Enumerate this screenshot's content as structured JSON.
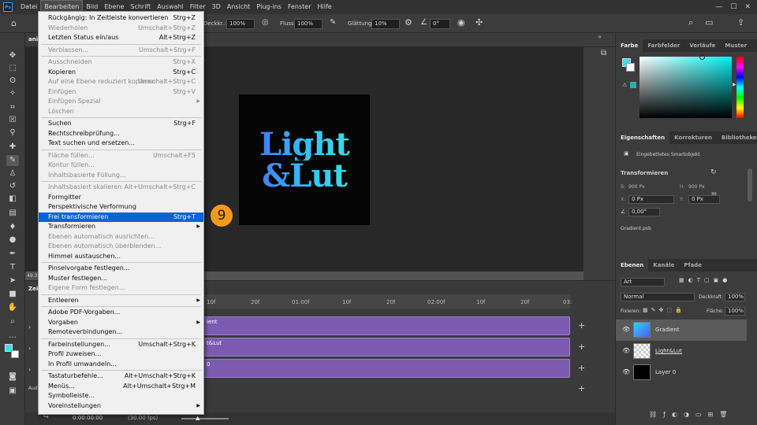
{
  "menubar": {
    "items": [
      "Datei",
      "Bearbeiten",
      "Bild",
      "Ebene",
      "Schrift",
      "Auswahl",
      "Filter",
      "3D",
      "Ansicht",
      "Plug-ins",
      "Fenster",
      "Hilfe"
    ],
    "active_index": 1
  },
  "options": {
    "deckkr_label": "Deckkr.:",
    "deckkr_value": "100%",
    "fluss_label": "Fluss:",
    "fluss_value": "100%",
    "glaettung_label": "Glättung:",
    "glaettung_value": "10%",
    "angle_value": "0°"
  },
  "doc": {
    "tab_title": "ani",
    "zoom": "49.3",
    "artboard_line1": "Light",
    "artboard_line2": "&Lut"
  },
  "badge": {
    "number": "9"
  },
  "menu": {
    "rows": [
      {
        "label": "Rückgängig: In Zeitleiste konvertieren",
        "shortcut": "Strg+Z",
        "disabled": false
      },
      {
        "label": "Wiederholen",
        "shortcut": "Umschalt+Strg+Z",
        "disabled": true
      },
      {
        "label": "Letzten Status ein/aus",
        "shortcut": "Alt+Strg+Z",
        "disabled": false
      },
      {
        "sep": true
      },
      {
        "label": "Verblassen...",
        "shortcut": "Umschalt+Strg+F",
        "disabled": true
      },
      {
        "sep": true
      },
      {
        "label": "Ausschneiden",
        "shortcut": "Strg+X",
        "disabled": true
      },
      {
        "label": "Kopieren",
        "shortcut": "Strg+C",
        "disabled": false
      },
      {
        "label": "Auf eine Ebene reduziert kopieren",
        "shortcut": "Umschalt+Strg+C",
        "disabled": true
      },
      {
        "label": "Einfügen",
        "shortcut": "Strg+V",
        "disabled": true
      },
      {
        "label": "Einfügen Spezial",
        "shortcut": "",
        "disabled": true,
        "submenu": true
      },
      {
        "label": "Löschen",
        "shortcut": "",
        "disabled": true
      },
      {
        "sep": true
      },
      {
        "label": "Suchen",
        "shortcut": "Strg+F",
        "disabled": false
      },
      {
        "label": "Rechtschreibprüfung...",
        "shortcut": "",
        "disabled": false
      },
      {
        "label": "Text suchen und ersetzen...",
        "shortcut": "",
        "disabled": false
      },
      {
        "sep": true
      },
      {
        "label": "Fläche füllen...",
        "shortcut": "Umschalt+F5",
        "disabled": true
      },
      {
        "label": "Kontur füllen...",
        "shortcut": "",
        "disabled": true
      },
      {
        "label": "Inhaltsbasierte Füllung...",
        "shortcut": "",
        "disabled": true
      },
      {
        "sep": true
      },
      {
        "label": "Inhaltsbasiert skalieren",
        "shortcut": "Alt+Umschalt+Strg+C",
        "disabled": true
      },
      {
        "label": "Formgitter",
        "shortcut": "",
        "disabled": false
      },
      {
        "label": "Perspektivische Verformung",
        "shortcut": "",
        "disabled": false
      },
      {
        "label": "Frei transformieren",
        "shortcut": "Strg+T",
        "disabled": false,
        "highlight": true
      },
      {
        "label": "Transformieren",
        "shortcut": "",
        "disabled": false,
        "submenu": true
      },
      {
        "label": "Ebenen automatisch ausrichten...",
        "shortcut": "",
        "disabled": true
      },
      {
        "label": "Ebenen automatisch überblenden...",
        "shortcut": "",
        "disabled": true
      },
      {
        "label": "Himmel austauschen...",
        "shortcut": "",
        "disabled": false
      },
      {
        "sep": true
      },
      {
        "label": "Pinselvorgabe festlegen...",
        "shortcut": "",
        "disabled": false
      },
      {
        "label": "Muster festlegen...",
        "shortcut": "",
        "disabled": false
      },
      {
        "label": "Eigene Form festlegen...",
        "shortcut": "",
        "disabled": true
      },
      {
        "sep": true
      },
      {
        "label": "Entleeren",
        "shortcut": "",
        "disabled": false,
        "submenu": true
      },
      {
        "sep": true
      },
      {
        "label": "Adobe PDF-Vorgaben...",
        "shortcut": "",
        "disabled": false
      },
      {
        "label": "Vorgaben",
        "shortcut": "",
        "disabled": false,
        "submenu": true
      },
      {
        "label": "Remoteverbindungen...",
        "shortcut": "",
        "disabled": false
      },
      {
        "sep": true
      },
      {
        "label": "Farbeinstellungen...",
        "shortcut": "Umschalt+Strg+K",
        "disabled": false
      },
      {
        "label": "Profil zuweisen...",
        "shortcut": "",
        "disabled": false
      },
      {
        "label": "In Profil umwandeln...",
        "shortcut": "",
        "disabled": false
      },
      {
        "sep": true
      },
      {
        "label": "Tastaturbefehle...",
        "shortcut": "Alt+Umschalt+Strg+K",
        "disabled": false
      },
      {
        "label": "Menüs...",
        "shortcut": "Alt+Umschalt+Strg+M",
        "disabled": false
      },
      {
        "label": "Symbolleiste...",
        "shortcut": "",
        "disabled": false
      },
      {
        "label": "Voreinstellungen",
        "shortcut": "",
        "disabled": false,
        "submenu": true
      }
    ]
  },
  "timeline": {
    "tab": "Zeit",
    "ruler": [
      "10f",
      "20f",
      "01:00f",
      "10f",
      "20f",
      "02:00f",
      "10f",
      "20f",
      "03:"
    ],
    "tracks": [
      "ient",
      "t&Lut",
      "0"
    ],
    "time": "0:00:00:00",
    "fps": "(30.00 fps)",
    "audio_label": "Audi"
  },
  "color_panel": {
    "tabs": [
      "Farbe",
      "Farbfelder",
      "Verläufe",
      "Muster"
    ]
  },
  "props": {
    "tabs": [
      "Eigenschaften",
      "Korrekturen",
      "Bibliotheken"
    ],
    "kind": "Eingebettetes Smartobjekt",
    "section": "Transformieren",
    "w_label": "B:",
    "w_value": "900 Px",
    "h_label": "H:",
    "h_value": "900 Px",
    "x_label": "X:",
    "x_value": "0 Px",
    "y_label": "Y:",
    "y_value": "0 Px",
    "angle": "0,00°",
    "file": "Gradient.psb"
  },
  "layers": {
    "tabs": [
      "Ebenen",
      "Kanäle",
      "Pfade"
    ],
    "filter_kind": "Art",
    "blend": "Normal",
    "opacity_label": "Deckkraft:",
    "opacity": "100%",
    "lock_label": "Fixieren:",
    "fill_label": "Fläche:",
    "fill": "100%",
    "items": [
      "Gradient",
      "Light&Lut",
      "Layer 0"
    ]
  },
  "colors": {
    "accent": "#0a64d8",
    "badge": "#f39a1b",
    "track": "#7b5bb0",
    "foreground": "#2ee6e6"
  }
}
